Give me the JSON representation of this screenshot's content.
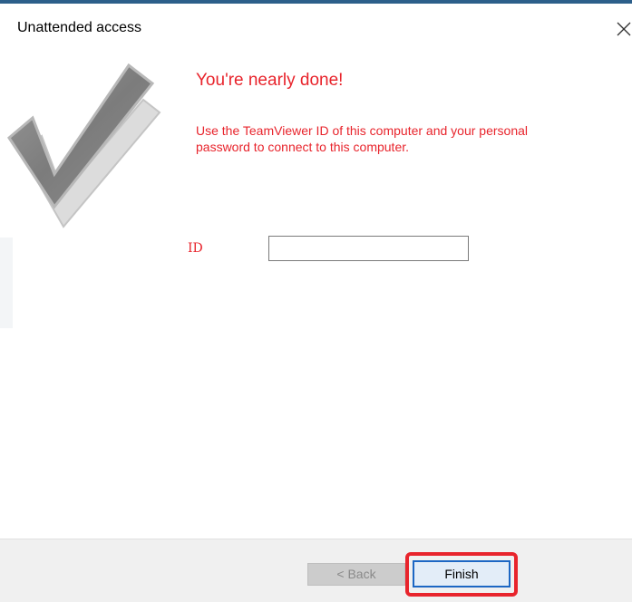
{
  "window": {
    "title": "Unattended access",
    "accent_color": "#2c5f8a"
  },
  "titlebar": {
    "close_icon": "close-icon"
  },
  "content": {
    "heading": "You're nearly done!",
    "instructions": "Use the TeamViewer ID of this computer and your personal password to connect to this computer.",
    "text_color": "#e8242c",
    "graphic_icon": "checkmark-icon"
  },
  "form": {
    "id_label": "ID",
    "id_value": ""
  },
  "footer": {
    "back_label": "< Back",
    "finish_label": "Finish",
    "highlight_color": "#e8242c"
  }
}
